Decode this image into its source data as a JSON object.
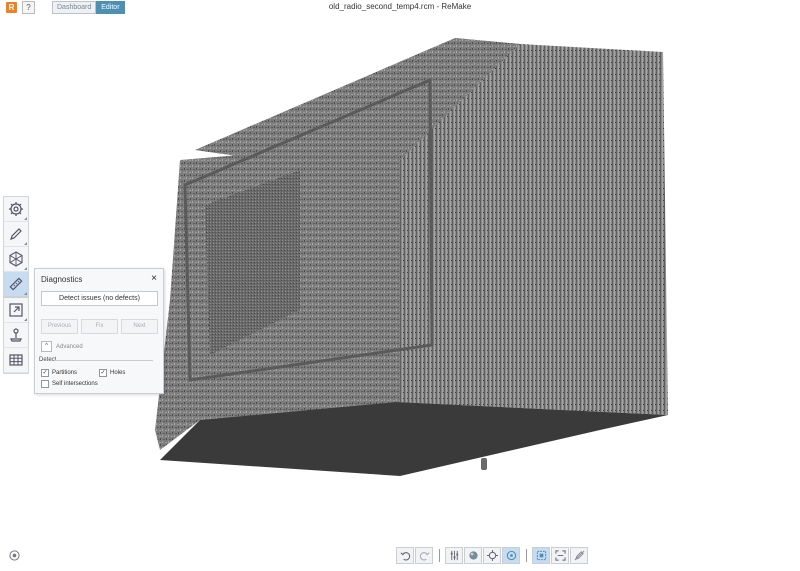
{
  "app": {
    "logo_letter": "R",
    "help_label": "?",
    "window_title": "old_radio_second_temp4.rcm - ReMake",
    "tabs": [
      {
        "label": "Dashboard",
        "active": false
      },
      {
        "label": "Editor",
        "active": true
      }
    ]
  },
  "left_toolbar": {
    "items": [
      {
        "name": "settings",
        "icon": "gear-icon"
      },
      {
        "name": "edit",
        "icon": "pencil-icon"
      },
      {
        "name": "select",
        "icon": "mesh-select-icon"
      },
      {
        "name": "diagnostics",
        "icon": "ruler-icon",
        "active": true
      },
      {
        "name": "export",
        "icon": "export-icon"
      },
      {
        "name": "publish",
        "icon": "joystick-icon"
      },
      {
        "name": "grid",
        "icon": "grid-icon"
      }
    ]
  },
  "diagnostics_panel": {
    "title": "Diagnostics",
    "close_label": "×",
    "detect_button": "Detect issues (no defects)",
    "nav": {
      "previous": "Previous",
      "fix": "Fix",
      "next": "Next"
    },
    "advanced_label": "Advanced",
    "advanced_toggle": "^",
    "detect_heading": "Detect",
    "options": [
      {
        "label": "Partitions",
        "checked": true
      },
      {
        "label": "Holes",
        "checked": true
      },
      {
        "label": "Self intersections",
        "checked": false
      }
    ]
  },
  "bottom_toolbar": {
    "icons": [
      "undo-icon",
      "redo-icon",
      "adjust-icon",
      "shading-icon",
      "orbit-center-icon",
      "info-icon",
      "select-frame-icon",
      "fit-view-icon",
      "no-edit-icon"
    ]
  },
  "colors": {
    "accent": "#4e8fb4",
    "active_tool": "#c7dcf0",
    "mesh_dark": "#3c3c3c",
    "mesh_mid": "#7a7a7a",
    "mesh_light": "#9a9a9a"
  }
}
